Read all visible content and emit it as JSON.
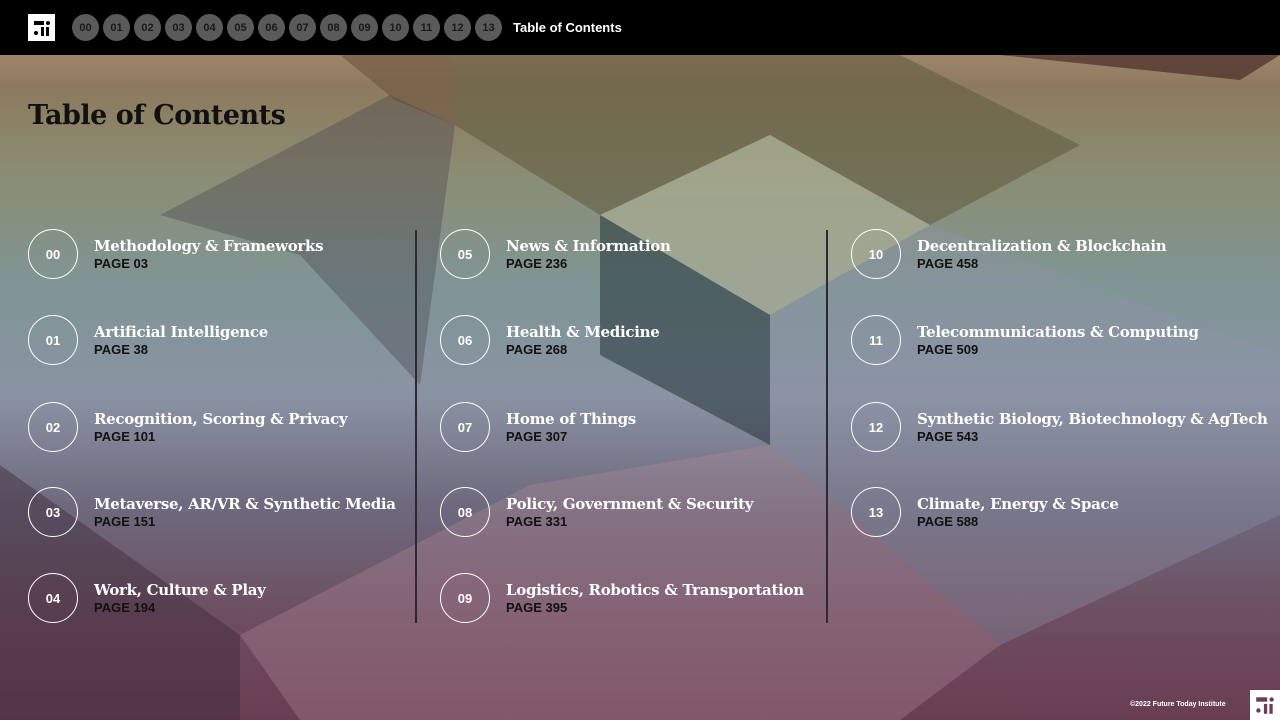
{
  "nav": {
    "numbers": [
      "00",
      "01",
      "02",
      "03",
      "04",
      "05",
      "06",
      "07",
      "08",
      "09",
      "10",
      "11",
      "12",
      "13"
    ],
    "title": "Table of Contents"
  },
  "page_title": "Table of Contents",
  "items": [
    {
      "num": "00",
      "title": "Methodology & Frameworks",
      "page": "PAGE 03"
    },
    {
      "num": "01",
      "title": "Artificial Intelligence",
      "page": "PAGE 38"
    },
    {
      "num": "02",
      "title": "Recognition, Scoring & Privacy",
      "page": "PAGE 101"
    },
    {
      "num": "03",
      "title": "Metaverse, AR/VR & Synthetic Media",
      "page": "PAGE 151"
    },
    {
      "num": "04",
      "title": "Work, Culture & Play",
      "page": "PAGE 194"
    },
    {
      "num": "05",
      "title": "News & Information",
      "page": "PAGE 236"
    },
    {
      "num": "06",
      "title": "Health & Medicine",
      "page": "PAGE 268"
    },
    {
      "num": "07",
      "title": "Home of Things",
      "page": "PAGE 307"
    },
    {
      "num": "08",
      "title": "Policy, Government & Security",
      "page": "PAGE 331"
    },
    {
      "num": "09",
      "title": "Logistics, Robotics & Transportation",
      "page": "PAGE 395"
    },
    {
      "num": "10",
      "title": "Decentralization & Blockchain",
      "page": "PAGE 458"
    },
    {
      "num": "11",
      "title": "Telecommunications & Computing",
      "page": "PAGE 509"
    },
    {
      "num": "12",
      "title": "Synthetic Biology, Biotechnology & AgTech",
      "page": "PAGE 543"
    },
    {
      "num": "13",
      "title": "Climate, Energy & Space",
      "page": "PAGE 588"
    }
  ],
  "footer": {
    "copyright": "©2022 Future Today Institute"
  }
}
